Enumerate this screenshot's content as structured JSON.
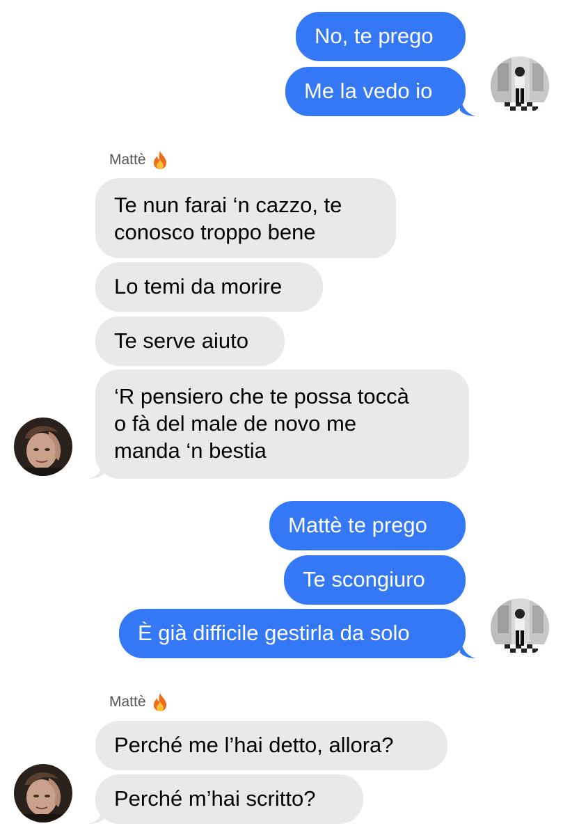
{
  "colors": {
    "sent_bubble": "#3478f6",
    "received_bubble": "#e9e9eb",
    "sender_label": "#555559"
  },
  "messages": {
    "sent_1": "No, te prego",
    "sent_2": "Me la vedo io",
    "group_1_sender": "Mattè",
    "recv_1_line1": "Te nun farai ‘n cazzo, te",
    "recv_1_line2": "conosco troppo bene",
    "recv_2": "Lo temi da morire",
    "recv_3": "Te serve aiuto",
    "recv_4_line1": "‘R pensiero che te possa toccà",
    "recv_4_line2": "o fà del male de novo me",
    "recv_4_line3": "manda ‘n bestia",
    "sent_3": "Mattè te prego",
    "sent_4": "Te scongiuro",
    "sent_5": "È già difficile gestirla da solo",
    "group_2_sender": "Mattè",
    "recv_5": "Perché me l’hai detto, allora?",
    "recv_6": "Perché m’hai scritto?"
  },
  "icons": {
    "sender_badge": "fire-icon"
  }
}
